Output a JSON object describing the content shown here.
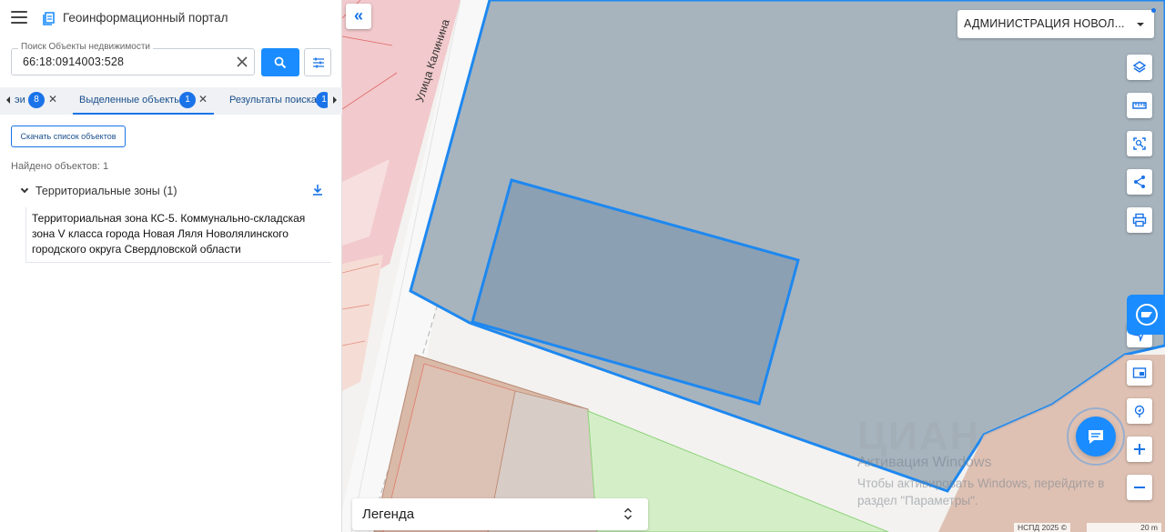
{
  "header": {
    "title": "Геоинформационный портал"
  },
  "search": {
    "label": "Поиск Объекты недвижимости",
    "value": "66:18:0914003:528"
  },
  "tabs": [
    {
      "label": "эи",
      "count": "8"
    },
    {
      "label": "Выделенные объекты",
      "count": "1",
      "active": true
    },
    {
      "label": "Результаты поиска",
      "count": "1"
    }
  ],
  "results": {
    "download_list_label": "Скачать список объектов",
    "found_text": "Найдено объектов: 1",
    "group_label": "Территориальные зоны (1)",
    "item_text": "Территориальная зона КС-5. Коммунально-складская зона V класса города Новая Ляля Новолялинского городского округа Свердловской области"
  },
  "map": {
    "street_label": "Улица Калинина",
    "admin_select": "АДМИНИСТРАЦИЯ НОВОЛ...",
    "legend_label": "Легенда",
    "watermark_title": "Активация Windows",
    "watermark_text": "Чтобы активировать Windows, перейдите в раздел \"Параметры\".",
    "cian_mark": "ЦИАН",
    "attribution": "НСПД 2025 ©",
    "scale": "20 m",
    "tools": [
      "layers-icon",
      "ruler-icon",
      "select-area-icon",
      "share-icon",
      "print-icon",
      "location-arrow-icon",
      "picture-in-picture-icon",
      "geolocation-icon",
      "zoom-in-icon",
      "zoom-out-icon"
    ]
  },
  "colors": {
    "accent": "#1a8cff",
    "selection_outline": "#1e88f0",
    "zone_fill": "#a7b4be",
    "parcel_fill": "#8ca0b3",
    "pink_zone": "#f2c4c8",
    "brown_zone": "#d9b9a8",
    "green_zone": "#d4efc8"
  }
}
